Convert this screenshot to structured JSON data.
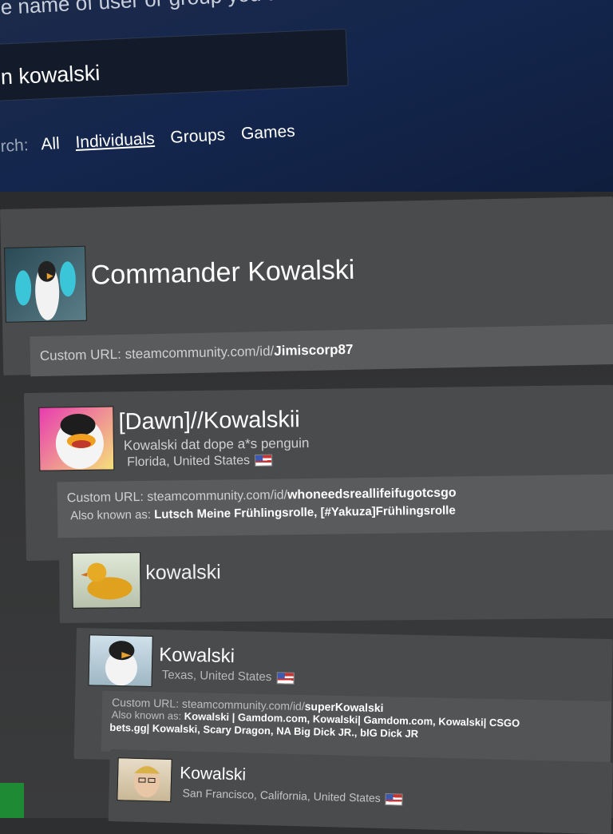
{
  "header": {
    "prompt": "e name of user or group you are looking for:",
    "search_value": "n kowalski",
    "filter_label": "rch:",
    "filters": [
      "All",
      "Individuals",
      "Groups",
      "Games"
    ]
  },
  "results": [
    {
      "name": "Commander Kowalski",
      "custom_url_label": "Custom URL: steamcommunity.com/id/",
      "custom_url_id": "Jimiscorp87",
      "avatar": "penguin-portal-icon"
    },
    {
      "name": "[Dawn]//Kowalskii",
      "summary": "Kowalski dat dope a*s penguin",
      "location": "Florida, United States",
      "custom_url_label": "Custom URL: steamcommunity.com/id/",
      "custom_url_id": "whoneedsreallifeifugotcsgo",
      "aka_label": "Also known as:",
      "aka_value": "Lutsch Meine Frühlingsrolle, [#Yakuza]Frühlingsrolle",
      "avatar": "duck-cartoon-icon"
    },
    {
      "name": "kowalski",
      "avatar": "rubber-duck-icon"
    },
    {
      "name": "Kowalski",
      "location": "Texas, United States",
      "custom_url_label": "Custom URL: steamcommunity.com/id/",
      "custom_url_id": "superKowalski",
      "aka_label": "Also known as:",
      "aka_line1": "Kowalski | Gamdom.com, Kowalski| Gamdom.com, Kowalski| CSGO",
      "aka_line2": "bets.gg| Kowalski, Scary Dragon, NA Big Dick JR., bIG Dick JR",
      "avatar": "penguin-icon"
    },
    {
      "name": "Kowalski",
      "location": "San Francisco, California, United States",
      "avatar": "person-photo-icon"
    }
  ],
  "colors": {
    "header_blue": "#14264d",
    "card_gray": "#4a4b4d",
    "subpanel_gray": "#5a5b5d"
  }
}
